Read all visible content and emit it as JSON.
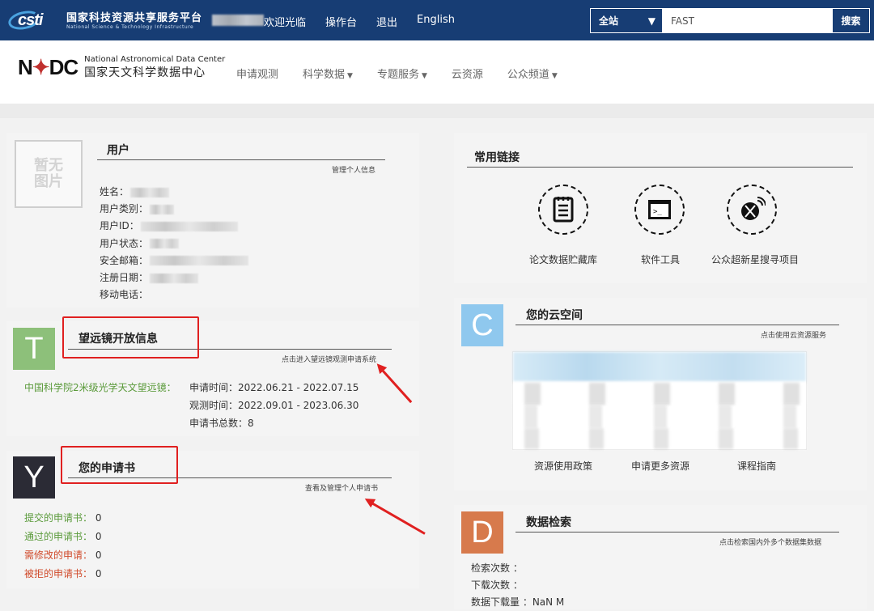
{
  "topbar": {
    "logo_text": "csti",
    "platform_cn": "国家科技资源共享服务平台",
    "platform_en": "National Science & Technology Infrastructure",
    "welcome": "欢迎光临",
    "nav": [
      "操作台",
      "退出",
      "English"
    ],
    "search_scope": "全站",
    "search_value": "FAST",
    "search_button": "搜索"
  },
  "header": {
    "logo_mark_left": "N",
    "logo_mark_right": "DC",
    "name_en": "National Astronomical Data Center",
    "name_cn": "国家天文科学数据中心",
    "nav": [
      "申请观测",
      "科学数据",
      "专题服务",
      "云资源",
      "公众频道"
    ]
  },
  "user_panel": {
    "title": "用户",
    "manage_link": "管理个人信息",
    "avatar_text_line1": "暂无",
    "avatar_text_line2": "图片",
    "fields": [
      "姓名：",
      "用户类别：",
      "用户ID：",
      "用户状态：",
      "安全邮箱：",
      "注册日期：",
      "移动电话："
    ]
  },
  "telescope_panel": {
    "letter": "T",
    "title": "望远镜开放信息",
    "link": "点击进入望远镜观测申请系统",
    "telescope_name": "中国科学院2米级光学天文望远镜：",
    "apply_time": "申请时间：2022.06.21 - 2022.07.15",
    "observe_time": "观测时间：2022.09.01 - 2023.06.30",
    "total": "申请书总数：8"
  },
  "application_panel": {
    "letter": "Y",
    "title": "您的申请书",
    "link": "查看及管理个人申请书",
    "rows": [
      {
        "label": "提交的申请书：",
        "value": "0"
      },
      {
        "label": "通过的申请书：",
        "value": "0"
      },
      {
        "label": "需修改的申请：",
        "value": "0"
      },
      {
        "label": "被拒的申请书：",
        "value": "0"
      }
    ]
  },
  "links_panel": {
    "title": "常用链接",
    "items": [
      "论文数据贮藏库",
      "软件工具",
      "公众超新星搜寻项目"
    ]
  },
  "cloud_panel": {
    "letter": "C",
    "title": "您的云空间",
    "link": "点击使用云资源服务",
    "footer_links": [
      "资源使用政策",
      "申请更多资源",
      "课程指南"
    ]
  },
  "data_panel": {
    "letter": "D",
    "title": "数据检索",
    "link": "点击检索国内外多个数据集数据",
    "rows": [
      "检索次数 ：",
      "下载次数 ：",
      "数据下载量 ：NaN M"
    ]
  },
  "colors": {
    "topbar": "#173d74",
    "telescope_letter": "#8dc07a",
    "application_letter": "#2b2b35",
    "cloud_letter": "#8fc8ee",
    "data_letter": "#d77a4c",
    "annotation_red": "#e02020"
  }
}
